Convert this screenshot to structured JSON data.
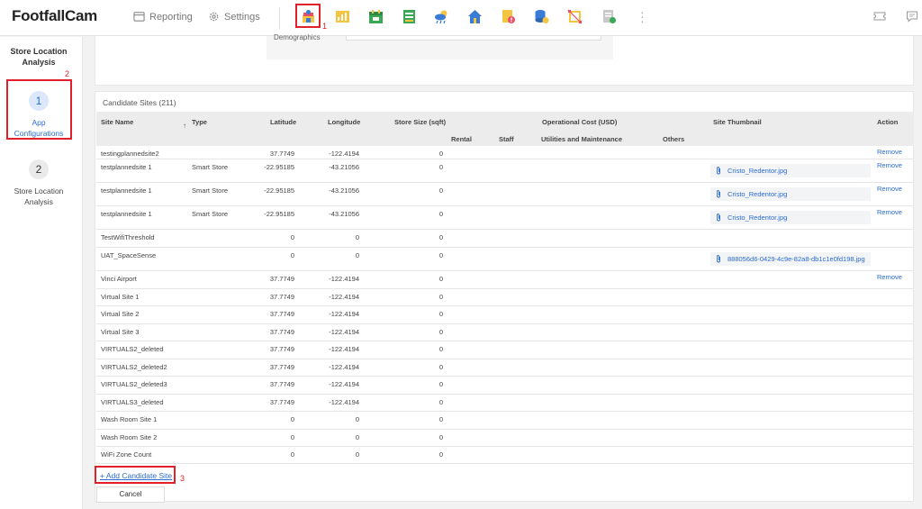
{
  "app": {
    "logo": "FootfallCam"
  },
  "nav": {
    "reporting": "Reporting",
    "settings": "Settings"
  },
  "annotations": {
    "one": "1",
    "two": "2",
    "three": "3"
  },
  "colors": {
    "highlight": "#e0202a",
    "link": "#2b6cd4",
    "active_step": "#2b6cd4",
    "header_bg": "#ececec"
  },
  "toolbar_icons": [
    "store-location-analysis-icon",
    "report-icon",
    "calendar-icon",
    "spreadsheet-icon",
    "weather-icon",
    "home-icon",
    "document-alert-icon",
    "database-icon",
    "crop-icon",
    "file-settings-icon"
  ],
  "sidebar": {
    "title": "Store Location Analysis",
    "steps": [
      {
        "number": "1",
        "label": "App Configurations",
        "active": true
      },
      {
        "number": "2",
        "label": "Store Location Analysis",
        "active": false
      }
    ]
  },
  "demographics_label": "Demographics",
  "candidate": {
    "title": "Candidate Sites (211)",
    "headers": {
      "site_name": "Site Name",
      "type": "Type",
      "latitude": "Latitude",
      "longitude": "Longitude",
      "store_size": "Store Size (sqft)",
      "operational_cost": "Operational Cost (USD)",
      "rental": "Rental",
      "staff": "Staff",
      "utilities": "Utilities and Maintenance",
      "others": "Others",
      "thumbnail": "Site Thumbnail",
      "action": "Action"
    },
    "rows": [
      {
        "name": "testingplannedsite2",
        "type": "",
        "lat": "37.7749",
        "lng": "-122.4194",
        "size": "0",
        "thumb": "",
        "action": "Remove"
      },
      {
        "name": "testplannedsite 1",
        "type": "Smart Store",
        "lat": "-22.95185",
        "lng": "-43.21056",
        "size": "0",
        "thumb": "Cristo_Redentor.jpg",
        "action": "Remove"
      },
      {
        "name": "testplannedsite 1",
        "type": "Smart Store",
        "lat": "-22.95185",
        "lng": "-43.21056",
        "size": "0",
        "thumb": "Cristo_Redentor.jpg",
        "action": "Remove"
      },
      {
        "name": "testplannedsite 1",
        "type": "Smart Store",
        "lat": "-22.95185",
        "lng": "-43.21056",
        "size": "0",
        "thumb": "Cristo_Redentor.jpg",
        "action": "Remove"
      },
      {
        "name": "TestWifiThreshold",
        "type": "",
        "lat": "0",
        "lng": "0",
        "size": "0",
        "thumb": "",
        "action": ""
      },
      {
        "name": "UAT_SpaceSense",
        "type": "",
        "lat": "0",
        "lng": "0",
        "size": "0",
        "thumb": "888056d6-0429-4c9e-82a8-db1c1e0fd198.jpg",
        "action": ""
      },
      {
        "name": "Vinci Airport",
        "type": "",
        "lat": "37.7749",
        "lng": "-122.4194",
        "size": "0",
        "thumb": "",
        "action": "Remove"
      },
      {
        "name": "Virtual Site 1",
        "type": "",
        "lat": "37.7749",
        "lng": "-122.4194",
        "size": "0",
        "thumb": "",
        "action": ""
      },
      {
        "name": "Virtual Site 2",
        "type": "",
        "lat": "37.7749",
        "lng": "-122.4194",
        "size": "0",
        "thumb": "",
        "action": ""
      },
      {
        "name": "Virtual Site 3",
        "type": "",
        "lat": "37.7749",
        "lng": "-122.4194",
        "size": "0",
        "thumb": "",
        "action": ""
      },
      {
        "name": "VIRTUALS2_deleted",
        "type": "",
        "lat": "37.7749",
        "lng": "-122.4194",
        "size": "0",
        "thumb": "",
        "action": ""
      },
      {
        "name": "VIRTUALS2_deleted2",
        "type": "",
        "lat": "37.7749",
        "lng": "-122.4194",
        "size": "0",
        "thumb": "",
        "action": ""
      },
      {
        "name": "VIRTUALS2_deleted3",
        "type": "",
        "lat": "37.7749",
        "lng": "-122.4194",
        "size": "0",
        "thumb": "",
        "action": ""
      },
      {
        "name": "VIRTUALS3_deleted",
        "type": "",
        "lat": "37.7749",
        "lng": "-122.4194",
        "size": "0",
        "thumb": "",
        "action": ""
      },
      {
        "name": "Wash Room Site 1",
        "type": "",
        "lat": "0",
        "lng": "0",
        "size": "0",
        "thumb": "",
        "action": ""
      },
      {
        "name": "Wash Room Site 2",
        "type": "",
        "lat": "0",
        "lng": "0",
        "size": "0",
        "thumb": "",
        "action": ""
      },
      {
        "name": "WiFi Zone Count",
        "type": "",
        "lat": "0",
        "lng": "0",
        "size": "0",
        "thumb": "",
        "action": ""
      }
    ]
  },
  "actions": {
    "add_candidate": "+ Add Candidate Site",
    "cancel": "Cancel"
  }
}
